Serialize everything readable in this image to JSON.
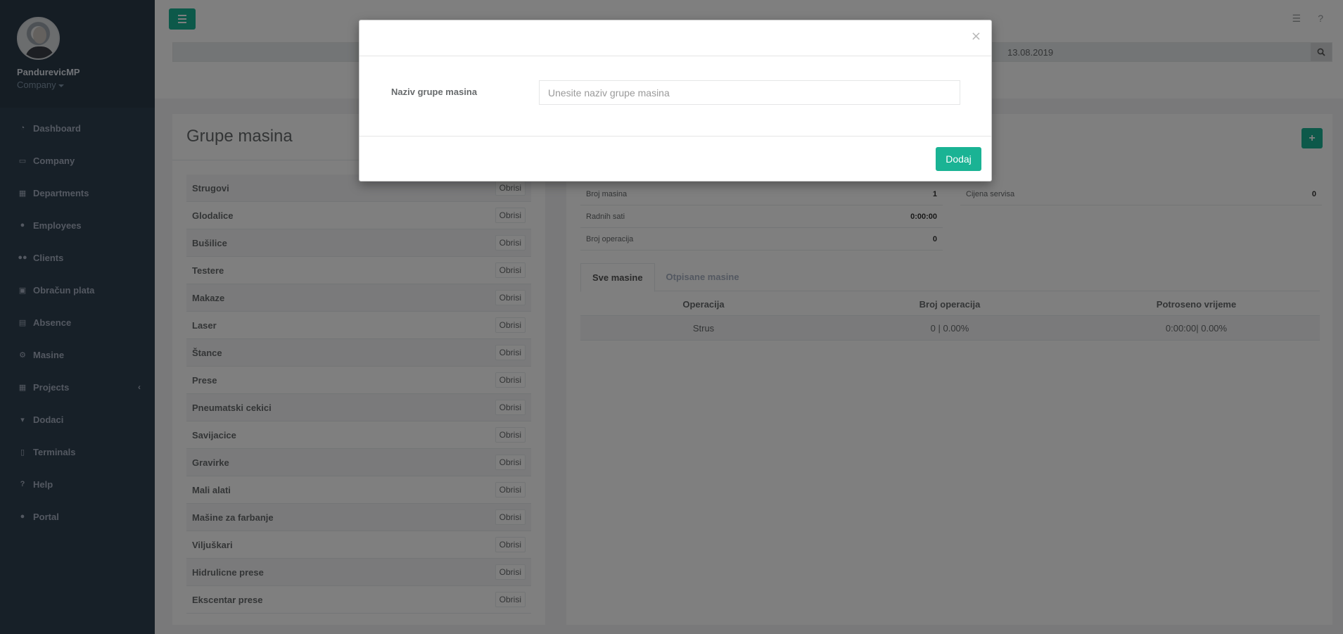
{
  "user": {
    "name": "PandurevicMP",
    "company": "Company"
  },
  "sidebar": {
    "items": [
      {
        "label": "Dashboard",
        "icon": "tachometer-icon"
      },
      {
        "label": "Company",
        "icon": "desktop-icon"
      },
      {
        "label": "Departments",
        "icon": "grid-icon"
      },
      {
        "label": "Employees",
        "icon": "user-icon"
      },
      {
        "label": "Clients",
        "icon": "users-icon"
      },
      {
        "label": "Obračun plata",
        "icon": "money-icon"
      },
      {
        "label": "Absence",
        "icon": "calendar-icon"
      },
      {
        "label": "Masine",
        "icon": "cogs-icon"
      },
      {
        "label": "Projects",
        "icon": "grid-icon"
      },
      {
        "label": "Dodaci",
        "icon": "cart-icon"
      },
      {
        "label": "Terminals",
        "icon": "tablet-icon"
      },
      {
        "label": "Help",
        "icon": "question-icon"
      },
      {
        "label": "Portal",
        "icon": "user-icon"
      }
    ]
  },
  "topbar": {
    "date": "13.08.2019"
  },
  "groups": {
    "title": "Grupe masina",
    "delete_label": "Obrisi",
    "items": [
      "Strugovi",
      "Glodalice",
      "Bušilice",
      "Testere",
      "Makaze",
      "Laser",
      "Štance",
      "Prese",
      "Pneumatski cekici",
      "Savijacice",
      "Gravirke",
      "Mali alati",
      "Mašine za farbanje",
      "Viljuškari",
      "Hidrulicne prese",
      "Ekscentar prese"
    ]
  },
  "details": {
    "add_label": "+",
    "stats_left": [
      {
        "label": "Broj masina",
        "value": "1"
      },
      {
        "label": "Radnih sati",
        "value": "0:00:00"
      },
      {
        "label": "Broj operacija",
        "value": "0"
      }
    ],
    "stats_right": [
      {
        "label": "Cijena servisa",
        "value": "0"
      }
    ],
    "tabs": [
      "Sve masine",
      "Otpisane masine"
    ],
    "table": {
      "headers": [
        "Operacija",
        "Broj operacija",
        "Potroseno vrijeme"
      ],
      "rows": [
        [
          "Strus",
          "0 | 0.00%",
          "0:00:00| 0.00%"
        ]
      ]
    }
  },
  "modal": {
    "close": "×",
    "field_label": "Naziv grupe masina",
    "field_placeholder": "Unesite naziv grupe masina",
    "field_value": "",
    "submit_label": "Dodaj"
  },
  "colors": {
    "sidebar": "#2f4050",
    "accent": "#1ab394"
  }
}
